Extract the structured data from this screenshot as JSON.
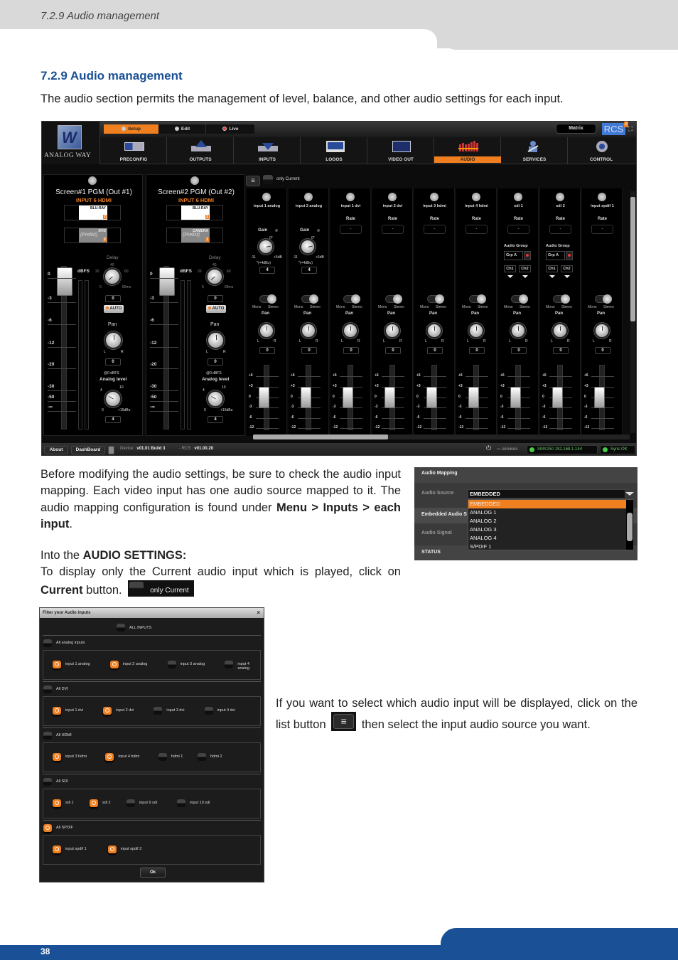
{
  "header": {
    "running_title": "7.2.9 Audio management"
  },
  "section": {
    "title": "7.2.9 Audio management",
    "intro": "The audio section permits the management of level, balance, and other audio settings for each input."
  },
  "body": {
    "para1_a": "Before modifying the audio settings, be sure to check the audio input mapping. Each video input has one audio source mapped to it. The audio mapping configuration is found under ",
    "para1_b": "Menu > Inputs > each input",
    "para1_c": ".",
    "para2_a": "Into the ",
    "para2_b": "AUDIO SETTINGS:",
    "para3_a": "To display only the Current audio input which is played, click on ",
    "para3_b": "Current",
    "para3_c": " button.",
    "inline_only_current": "only Current",
    "para4_a": "If you want to select which audio input will be displayed, click on the list button",
    "para4_b": "then select the input audio source you want."
  },
  "app": {
    "logo": "ANALOG WAY",
    "modes": [
      {
        "label": "Setup",
        "active": true
      },
      {
        "label": "Edit",
        "active": false
      },
      {
        "label": "Live",
        "active": false
      }
    ],
    "matrix_label": "Matrix",
    "rcs_label": "RCS",
    "rcs_version_badge": "2",
    "nav": [
      {
        "label": "PRECONFIG",
        "icon": "preconfig-icon"
      },
      {
        "label": "OUTPUTS",
        "icon": "outputs-icon"
      },
      {
        "label": "INPUTS",
        "icon": "inputs-icon"
      },
      {
        "label": "LOGOS",
        "icon": "logos-icon"
      },
      {
        "label": "VIDEO OUT",
        "icon": "video-out-icon"
      },
      {
        "label": "AUDIO",
        "icon": "audio-icon",
        "active": true
      },
      {
        "label": "SERVICES",
        "icon": "services-icon"
      },
      {
        "label": "CONTROL",
        "icon": "control-icon"
      }
    ],
    "outputs": [
      {
        "title": "Screen#1 PGM (Out #1)",
        "input": "INPUT 6 HDMI",
        "program": {
          "name": "BLU-RAY",
          "num": "2"
        },
        "preview": {
          "name": "DVD",
          "tag": "(Prelist)",
          "num": "2"
        },
        "delay": "0",
        "pan": "0",
        "analog_level": "4"
      },
      {
        "title": "Screen#2 PGM (Out #2)",
        "input": "INPUT 6 HDMI",
        "program": {
          "name": "BLU-RAY",
          "num": "2"
        },
        "preview": {
          "name": "CAMERA",
          "tag": "(Prelist)",
          "num": "1"
        },
        "delay": "0",
        "pan": "0",
        "analog_level": "4"
      }
    ],
    "output_labels": {
      "dbfs": "dBFS",
      "delay": "Delay",
      "delay_ticks": [
        "0",
        "20",
        "40",
        "60",
        "80ms"
      ],
      "auto": "AUTO",
      "pan": "Pan",
      "left": "L",
      "right": "R",
      "at_dbfs": "@0 dBFS",
      "analog_level": "Analog level",
      "analog_ticks": [
        "0",
        "4",
        "10",
        "+15dBu"
      ],
      "fader_scale": [
        "0",
        "-3",
        "-6",
        "-12",
        "-20",
        "-30",
        "-50",
        "-∞"
      ]
    },
    "only_current_label": "only Current",
    "strip_labels": {
      "rate": "Rate",
      "gain": "Gain",
      "gain_min": "-11",
      "gain_zero": "0*",
      "gain_max": "+6dB",
      "gain_note": "*(+4dBu)",
      "mono": "Mono",
      "stereo": "Stereo",
      "pan": "Pan",
      "left": "L",
      "right": "R",
      "audio_group": "Audio Group",
      "grp": "Grp A",
      "ch1": "Ch1",
      "ch2": "Ch2",
      "fader_scale": [
        "+6",
        "+3",
        "0",
        "-3",
        "-6",
        "-12"
      ]
    },
    "strips": [
      {
        "name": "input 1 analog",
        "type": "analog",
        "gain": "4",
        "pan": "0"
      },
      {
        "name": "input 2 analog",
        "type": "analog",
        "gain": "4",
        "pan": "0"
      },
      {
        "name": "input 1 dvi",
        "type": "digital",
        "rate": "-",
        "pan": "0"
      },
      {
        "name": "input 2 dvi",
        "type": "digital",
        "rate": "-",
        "pan": "0"
      },
      {
        "name": "input 3 hdmi",
        "type": "digital",
        "rate": "-",
        "pan": "0"
      },
      {
        "name": "input 4 hdmi",
        "type": "digital",
        "rate": "-",
        "pan": "0"
      },
      {
        "name": "sdi 1",
        "type": "sdi",
        "rate": "-",
        "pan": "0"
      },
      {
        "name": "sdi 2",
        "type": "sdi",
        "rate": "-",
        "pan": "0"
      },
      {
        "name": "input spdif 1",
        "type": "digital",
        "rate": "-",
        "pan": "0"
      }
    ],
    "status": {
      "about": "About",
      "dashboard": "DashBoard",
      "device_label": "Device :",
      "device_version": "v01.01 Build 3",
      "rcs_label": "- RCS :",
      "rcs_version": "v01.00.20",
      "services": "services",
      "device_ip": "SMX250  192.168.1.144",
      "sync": "Sync OK"
    }
  },
  "audio_mapping": {
    "title": "Audio Mapping",
    "source_label": "Audio Source",
    "selected": "EMBEDDED",
    "options": [
      "EMBEDDED",
      "ANALOG 1",
      "ANALOG 2",
      "ANALOG 3",
      "ANALOG 4",
      "S/PDIF 1"
    ],
    "embedded_label": "Embedded Audio S",
    "signal_label": "Audio Signal",
    "status_label": "STATUS"
  },
  "filter_dialog": {
    "title": "Filter your Audio inputs",
    "close": "×",
    "all_inputs": "ALL INPUTS",
    "groups": [
      {
        "label": "All analog inputs",
        "checked": false,
        "items": [
          {
            "label": "input 1 analog",
            "checked": true
          },
          {
            "label": "input 2 analog",
            "checked": true
          },
          {
            "label": "input 3 analog",
            "checked": false
          },
          {
            "label": "input 4 analog",
            "checked": false
          }
        ]
      },
      {
        "label": "All DVI",
        "checked": false,
        "items": [
          {
            "label": "input 1 dvi",
            "checked": true
          },
          {
            "label": "input 2 dvi",
            "checked": true
          },
          {
            "label": "input 3 dvi",
            "checked": false
          },
          {
            "label": "input 4 dvi",
            "checked": false
          }
        ]
      },
      {
        "label": "All HDMI",
        "checked": false,
        "items": [
          {
            "label": "input 3 hdmi",
            "checked": true
          },
          {
            "label": "input 4 hdmi",
            "checked": true
          },
          {
            "label": "hdmi 1",
            "checked": false
          },
          {
            "label": "hdmi 2",
            "checked": false
          }
        ]
      },
      {
        "label": "All SDI",
        "checked": false,
        "items": [
          {
            "label": "sdi 1",
            "checked": true
          },
          {
            "label": "sdi 2",
            "checked": true
          },
          {
            "label": "input 9 sdi",
            "checked": false
          },
          {
            "label": "input 10 sdi",
            "checked": false
          }
        ]
      },
      {
        "label": "All SPDIF",
        "checked": true,
        "items": [
          {
            "label": "input spdif 1",
            "checked": true
          },
          {
            "label": "input spdif 2",
            "checked": true
          }
        ]
      }
    ],
    "ok": "Ok"
  },
  "footer": {
    "page_number": "38"
  }
}
